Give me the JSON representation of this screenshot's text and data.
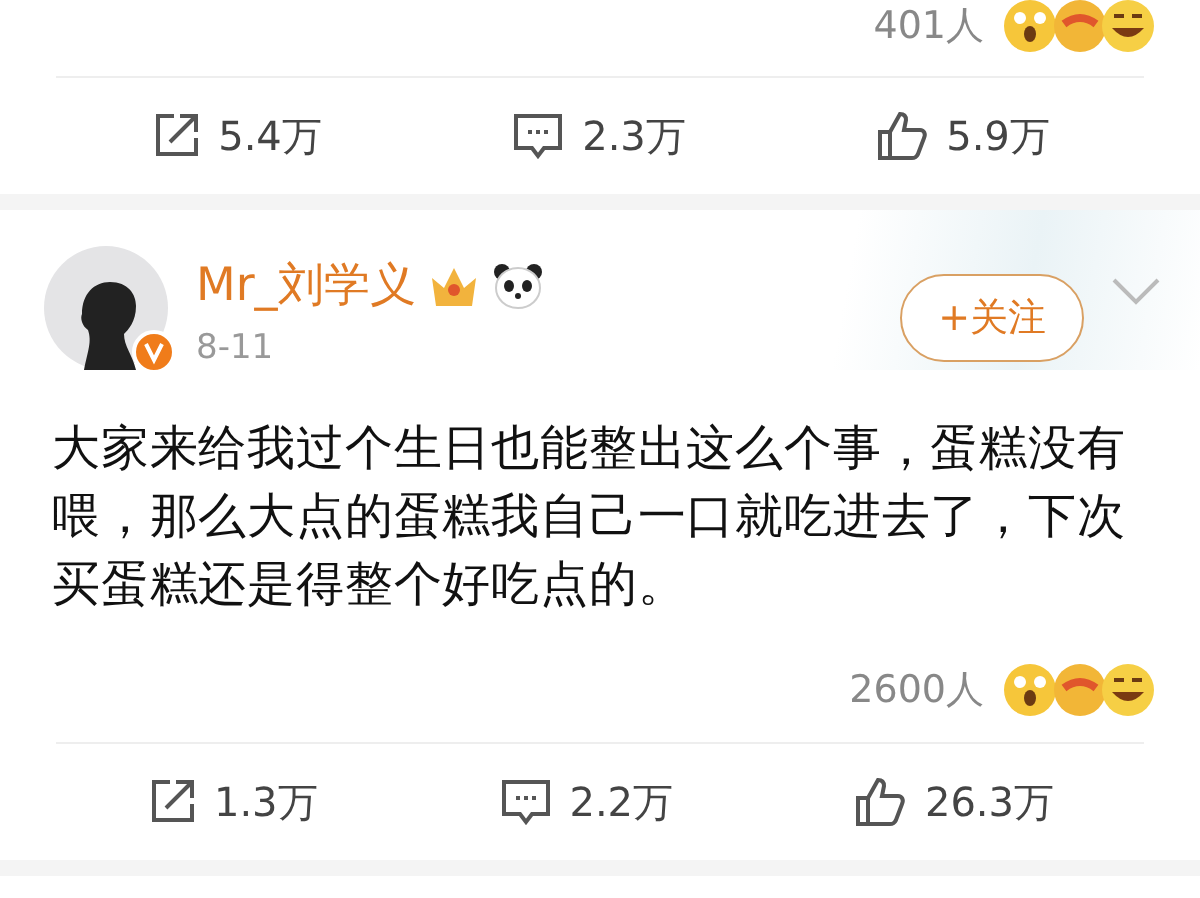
{
  "previous_post": {
    "reactions": {
      "count": "401人"
    },
    "actions": [
      {
        "kind": "repost",
        "count": "5.4万"
      },
      {
        "kind": "comment",
        "count": "2.3万"
      },
      {
        "kind": "like",
        "count": "5.9万"
      }
    ]
  },
  "post": {
    "author": {
      "name": "Mr_刘学义",
      "verified": true
    },
    "date": "8-11",
    "follow_button": "+关注",
    "text": "大家来给我过个生日也能整出这么个事，蛋糕没有喂，那么大点的蛋糕我自己一口就吃进去了，下次买蛋糕还是得整个好吃点的。",
    "reactions": {
      "count": "2600人"
    },
    "actions": [
      {
        "kind": "repost",
        "count": "1.3万"
      },
      {
        "kind": "comment",
        "count": "2.2万"
      },
      {
        "kind": "like",
        "count": "26.3万"
      }
    ]
  }
}
